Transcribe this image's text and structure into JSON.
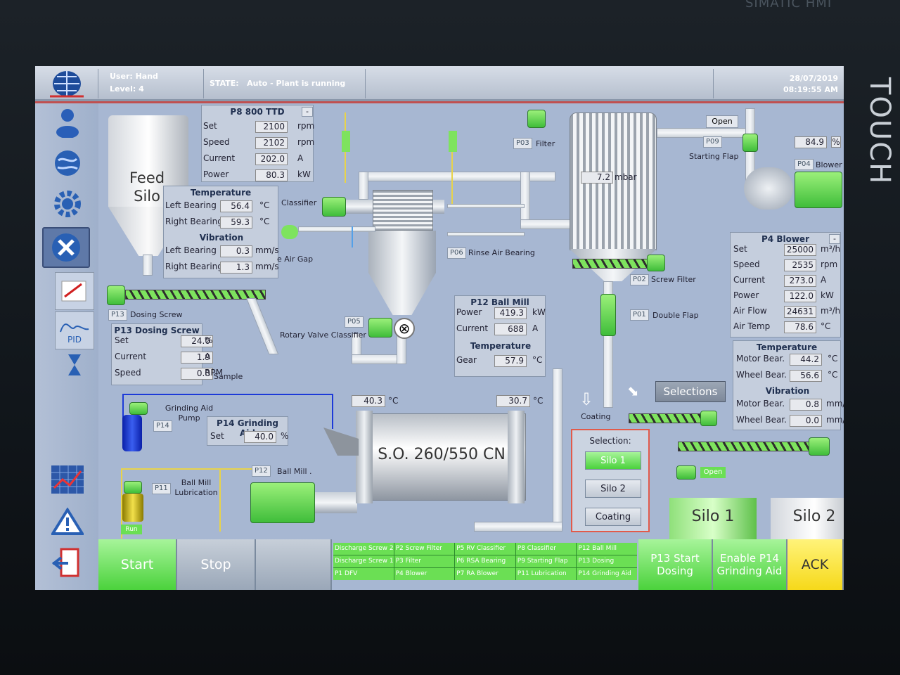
{
  "bezel": {
    "brand": "SIMATIC HMI",
    "touch": "TOUCH"
  },
  "header": {
    "user": "User: Hand",
    "level": "Level: 4",
    "state_label": "STATE:",
    "state_value": "Auto - Plant is running",
    "date": "28/07/2019",
    "time": "08:19:55 AM"
  },
  "sidebar": {
    "pid_label": "PID"
  },
  "feed_silo": {
    "line1": "Feed",
    "line2": "Silo"
  },
  "p8": {
    "title": "P8 800 TTD",
    "collapse": "-",
    "rows": [
      {
        "label": "Set",
        "value": "2100",
        "unit": "rpm"
      },
      {
        "label": "Speed",
        "value": "2102",
        "unit": "rpm"
      },
      {
        "label": "Current",
        "value": "202.0",
        "unit": "A"
      },
      {
        "label": "Power",
        "value": "80.3",
        "unit": "kW"
      }
    ]
  },
  "classifier_temp": {
    "title": "Temperature",
    "rows": [
      {
        "label": "Left Bearing",
        "value": "56.4",
        "unit": "°C"
      },
      {
        "label": "Right Bearing",
        "value": "59.3",
        "unit": "°C"
      }
    ],
    "vib_title": "Vibration",
    "vib_rows": [
      {
        "label": "Left Bearing",
        "value": "0.3",
        "unit": "mm/s"
      },
      {
        "label": "Right Bearing",
        "value": "1.3",
        "unit": "mm/s"
      }
    ]
  },
  "labels": {
    "classifier": "Classifier",
    "air_gap": "e Air Gap",
    "dosing_screw": "Dosing Screw",
    "rotary_valve": "Rotary Valve Classifier",
    "rinse": "Rinse Air Bearing",
    "filter": "Filter",
    "starting_flap": "Starting Flap",
    "blower": "Blower",
    "screw_filter": "Screw Filter",
    "double_flap": "Double Flap",
    "coating": "Coating",
    "grinding_aid_pump": "Grinding Aid Pump",
    "sample": "Sample",
    "ball_mill": "Ball Mill .",
    "ball_mill_lub": "Ball Mill Lubrication",
    "run": "Run",
    "open": "Open",
    "open2": "Open",
    "mill_name": "S.O. 260/550 CN"
  },
  "tags": {
    "p13": "P13",
    "p14": "P14",
    "p12": "P12",
    "p11": "P11",
    "p05": "P05",
    "p06": "P06",
    "p03": "P03",
    "p09": "P09",
    "p04": "P04",
    "p02": "P02",
    "p01": "P01"
  },
  "p13": {
    "title": "P13 Dosing Screw",
    "rows": [
      {
        "label": "Set",
        "value": "24.0",
        "unit": "%"
      },
      {
        "label": "Current",
        "value": "1.9",
        "unit": "A"
      },
      {
        "label": "Speed",
        "value": "0.0",
        "unit": "RPM"
      }
    ]
  },
  "p14": {
    "title": "P14 Grinding Aid",
    "rows": [
      {
        "label": "Set",
        "value": "40.0",
        "unit": "%"
      }
    ]
  },
  "p12": {
    "title": "P12 Ball Mill",
    "rows": [
      {
        "label": "Power",
        "value": "419.3",
        "unit": "kW"
      },
      {
        "label": "Current",
        "value": "688",
        "unit": "A"
      }
    ],
    "temp_title": "Temperature",
    "temp_rows": [
      {
        "label": "Gear",
        "value": "57.9",
        "unit": "°C"
      }
    ]
  },
  "mill_temps": {
    "left": "40.3",
    "right": "30.7",
    "unit": "°C"
  },
  "filter_pressure": {
    "value": "7.2",
    "unit": "mbar"
  },
  "blower_pct": {
    "value": "84.9",
    "unit": "%"
  },
  "p4": {
    "title": "P4 Blower",
    "collapse": "-",
    "rows": [
      {
        "label": "Set",
        "value": "25000",
        "unit": "m³/h"
      },
      {
        "label": "Speed",
        "value": "2535",
        "unit": "rpm"
      },
      {
        "label": "Current",
        "value": "273.0",
        "unit": "A"
      },
      {
        "label": "Power",
        "value": "122.0",
        "unit": "kW"
      },
      {
        "label": "Air Flow",
        "value": "24631",
        "unit": "m³/h"
      },
      {
        "label": "Air Temp",
        "value": "78.6",
        "unit": "°C"
      }
    ]
  },
  "p4_temp": {
    "title": "Temperature",
    "rows": [
      {
        "label": "Motor Bear.",
        "value": "44.2",
        "unit": "°C"
      },
      {
        "label": "Wheel Bear.",
        "value": "56.6",
        "unit": "°C"
      }
    ],
    "vib_title": "Vibration",
    "vib_rows": [
      {
        "label": "Motor Bear.",
        "value": "0.8",
        "unit": "mm/s"
      },
      {
        "label": "Wheel Bear.",
        "value": "0.0",
        "unit": "mm/s"
      }
    ]
  },
  "selections_button": "Selections",
  "selection": {
    "title": "Selection:",
    "options": [
      "Silo 1",
      "Silo 2",
      "Coating"
    ],
    "active": 0
  },
  "silos": {
    "silo1": "Silo 1",
    "silo2": "Silo 2"
  },
  "bottom": {
    "start": "Start",
    "stop": "Stop",
    "p13_start": "P13 Start Dosing",
    "enable_p14": "Enable P14 Grinding Aid",
    "ack": "ACK"
  },
  "status_grid": [
    "Discharge Screw 2",
    "P2 Screw Filter",
    "P5 RV Classifier",
    "P8 Classifier",
    "P12 Ball Mill",
    "Discharge Screw 1",
    "P3 Filter",
    "P6 RSA Bearing",
    "P9 Starting Flap",
    "P13 Dosing",
    "P1 DFV",
    "P4 Blower",
    "P7 RA Blower",
    "P11 Lubrication",
    "P14 Grinding Aid"
  ]
}
